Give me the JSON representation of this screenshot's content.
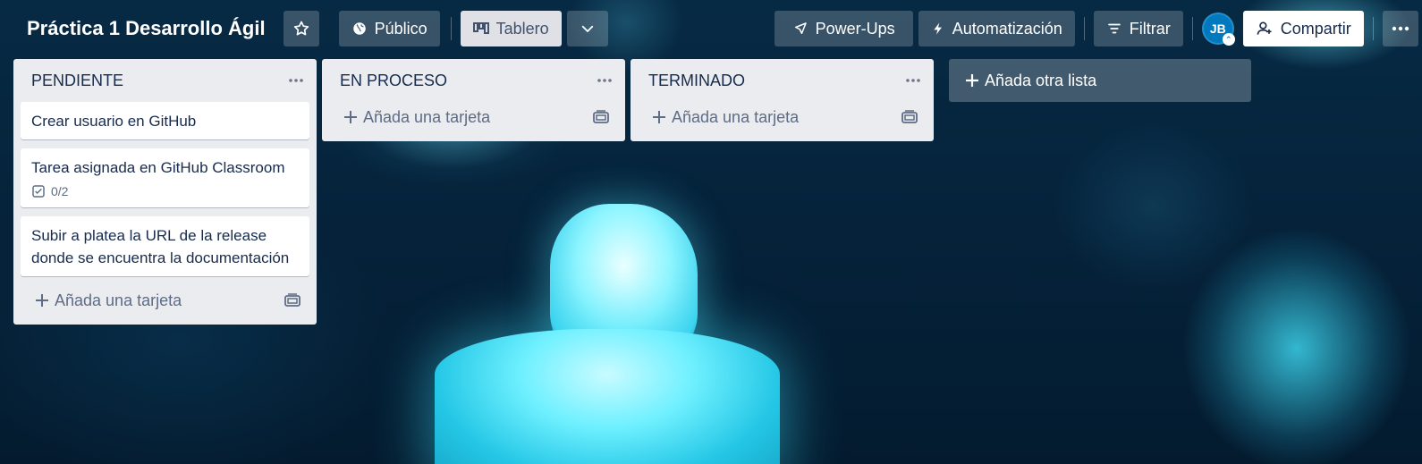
{
  "board": {
    "title": "Práctica 1 Desarrollo Ágil",
    "visibility_label": "Público",
    "view_label": "Tablero"
  },
  "toolbar": {
    "powerups_label": "Power-Ups",
    "automation_label": "Automatización",
    "filter_label": "Filtrar",
    "avatar_initials": "JB",
    "share_label": "Compartir"
  },
  "lists": [
    {
      "title": "PENDIENTE",
      "cards": [
        {
          "text": "Crear usuario en GitHub"
        },
        {
          "text": "Tarea asignada en GitHub Classroom",
          "checklist": "0/2"
        },
        {
          "text": "Subir a platea la URL de la release donde se encuentra la documentación"
        }
      ],
      "add_card_label": "Añada una tarjeta"
    },
    {
      "title": "EN PROCESO",
      "cards": [],
      "add_card_label": "Añada una tarjeta"
    },
    {
      "title": "TERMINADO",
      "cards": [],
      "add_card_label": "Añada una tarjeta"
    }
  ],
  "add_list_label": "Añada otra lista",
  "icons": {
    "star": "star-icon",
    "globe": "globe-icon",
    "board": "board-icon",
    "chevron": "chevron-down-icon",
    "rocket": "rocket-icon",
    "bolt": "bolt-icon",
    "filter": "filter-icon",
    "add_user": "add-user-icon",
    "more": "more-icon",
    "template": "card-template-icon",
    "checklist": "checklist-icon"
  }
}
